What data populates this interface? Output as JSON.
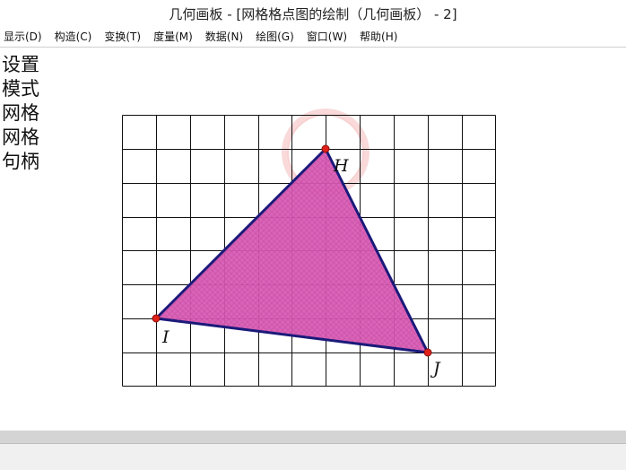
{
  "window": {
    "title": "几何画板 - [网格格点图的绘制（几何画板） - 2]"
  },
  "menu": [
    {
      "label": "显示(D)"
    },
    {
      "label": "构造(C)"
    },
    {
      "label": "变换(T)"
    },
    {
      "label": "度量(M)"
    },
    {
      "label": "数据(N)"
    },
    {
      "label": "绘图(G)"
    },
    {
      "label": "窗口(W)"
    },
    {
      "label": "帮助(H)"
    }
  ],
  "side_buttons": [
    {
      "label": "设置"
    },
    {
      "label": "模式"
    },
    {
      "label": "网格"
    },
    {
      "label": "网格"
    },
    {
      "label": "句柄"
    }
  ],
  "points": {
    "H": {
      "label": "H"
    },
    "I": {
      "label": "I"
    },
    "J": {
      "label": "J"
    }
  },
  "colors": {
    "triangle_fill": "#d95bb4",
    "triangle_stroke": "#1a1a7a",
    "point_fill": "#e0201a",
    "grid_line": "#111111",
    "highlight_ring": "#f3b0b0"
  }
}
